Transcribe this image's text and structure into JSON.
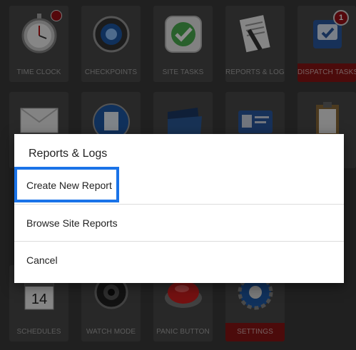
{
  "tiles": [
    {
      "id": "time-clock",
      "label": "TIME CLOCK",
      "icon": "stopwatch-icon"
    },
    {
      "id": "checkpoints",
      "label": "CHECKPOINTS",
      "icon": "camera-lens-icon"
    },
    {
      "id": "site-tasks",
      "label": "SITE TASKS",
      "icon": "checkmark-icon"
    },
    {
      "id": "reports-logs",
      "label": "REPORTS & LOGS",
      "icon": "document-pen-icon"
    },
    {
      "id": "dispatch-tasks",
      "label": "DISPATCH TASKS",
      "icon": "dispatch-icon",
      "badge": "1"
    },
    {
      "id": "schedules",
      "label": "SCHEDULES",
      "icon": "calendar-icon",
      "calendar_day": "14"
    },
    {
      "id": "watch-mode",
      "label": "WATCH MODE",
      "icon": "webcam-icon"
    },
    {
      "id": "panic-button",
      "label": "PANIC BUTTON",
      "icon": "red-button-icon"
    },
    {
      "id": "settings",
      "label": "SETTINGS",
      "icon": "gear-icon"
    }
  ],
  "dialog": {
    "title": "Reports & Logs",
    "items": [
      {
        "label": "Create New Report"
      },
      {
        "label": "Browse Site Reports"
      },
      {
        "label": "Cancel"
      }
    ]
  },
  "colors": {
    "background": "#3b3b3b",
    "tile": "#4a4a4a",
    "alert_red": "#8a1414",
    "highlight_blue": "#1a73e8"
  }
}
